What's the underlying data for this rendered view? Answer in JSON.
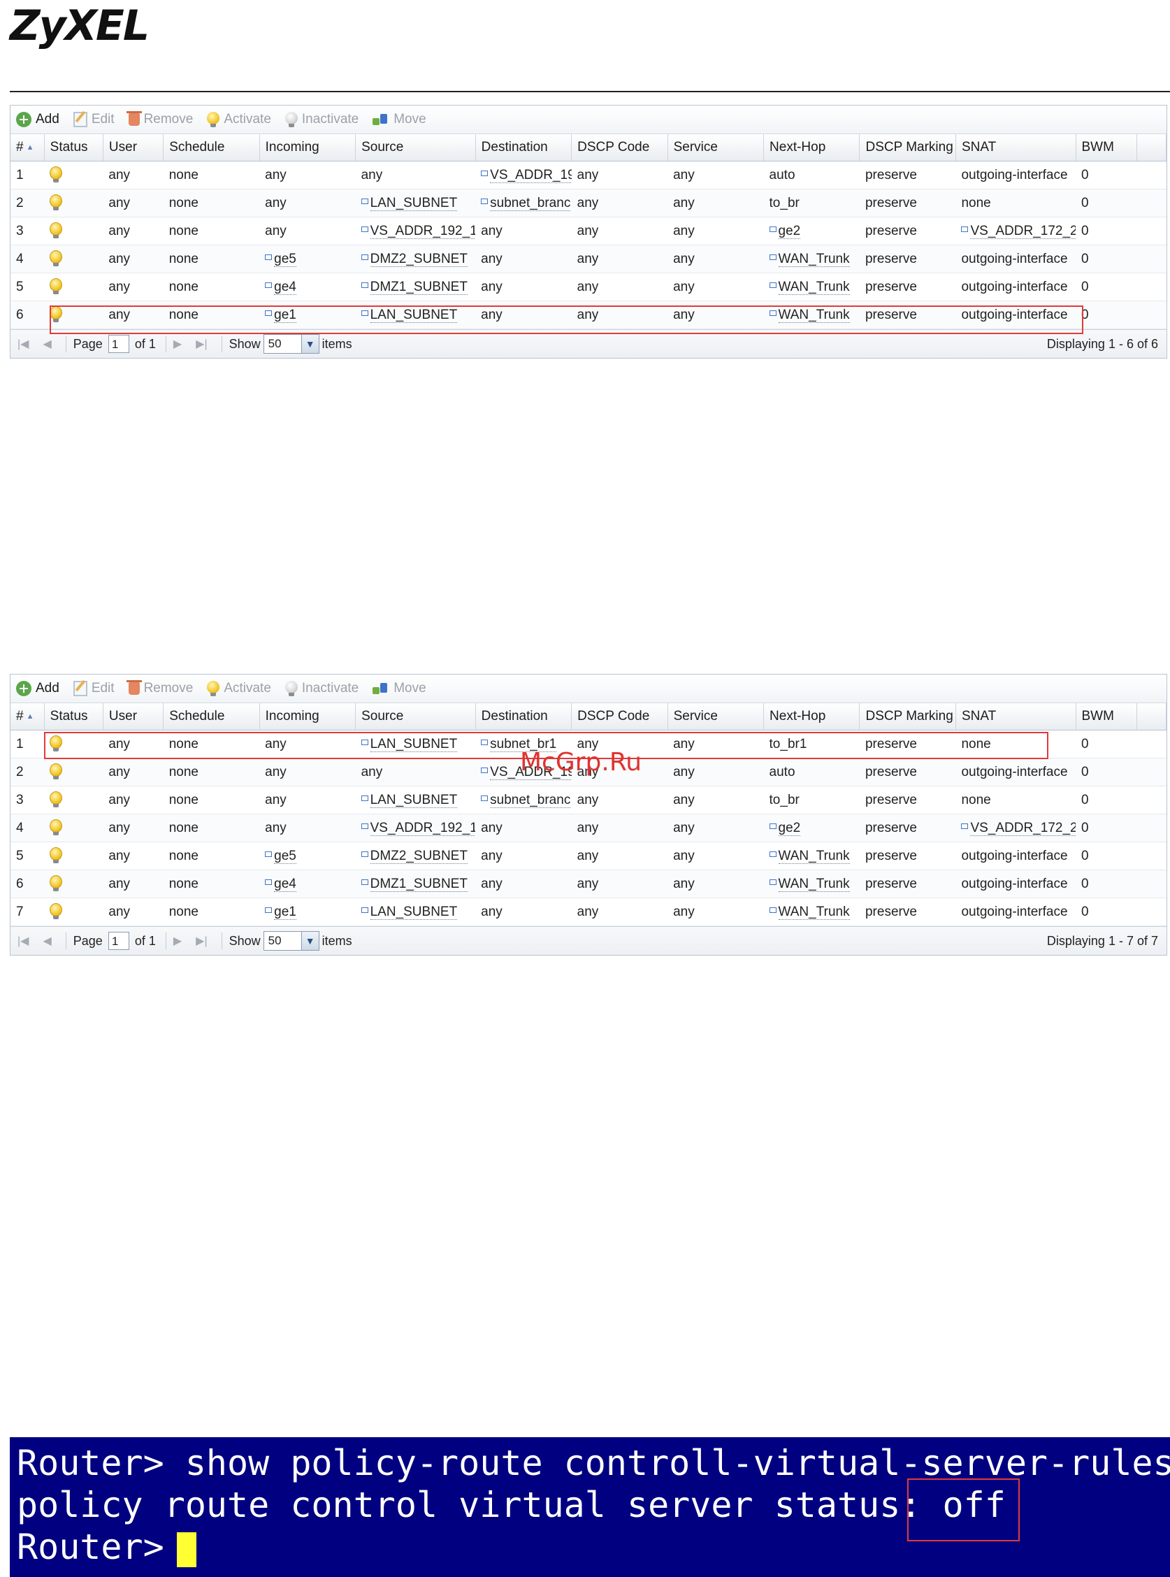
{
  "brand": {
    "logo_text": "ZyXEL"
  },
  "toolbar": {
    "add": "Add",
    "edit": "Edit",
    "remove": "Remove",
    "activate": "Activate",
    "inactivate": "Inactivate",
    "move": "Move"
  },
  "columns": [
    "#",
    "Status",
    "User",
    "Schedule",
    "Incoming",
    "Source",
    "Destination",
    "DSCP Code",
    "Service",
    "Next-Hop",
    "DSCP Marking",
    "SNAT",
    "BWM"
  ],
  "table1": {
    "rows": [
      {
        "num": "1",
        "user": "any",
        "schedule": "none",
        "incoming": "any",
        "source": "any",
        "destination": "VS_ADDR_19",
        "dscp_code": "any",
        "service": "any",
        "next_hop": "auto",
        "dscp_marking": "preserve",
        "snat": "outgoing-interface",
        "bwm": "0"
      },
      {
        "num": "2",
        "user": "any",
        "schedule": "none",
        "incoming": "any",
        "source": "LAN_SUBNET",
        "destination": "subnet_branc",
        "dscp_code": "any",
        "service": "any",
        "next_hop": "to_br",
        "dscp_marking": "preserve",
        "snat": "none",
        "bwm": "0"
      },
      {
        "num": "3",
        "user": "any",
        "schedule": "none",
        "incoming": "any",
        "source": "VS_ADDR_192_1(",
        "destination": "any",
        "dscp_code": "any",
        "service": "any",
        "next_hop": "ge2",
        "dscp_marking": "preserve",
        "snat": "VS_ADDR_172_2!",
        "bwm": "0"
      },
      {
        "num": "4",
        "user": "any",
        "schedule": "none",
        "incoming": "ge5",
        "source": "DMZ2_SUBNET",
        "destination": "any",
        "dscp_code": "any",
        "service": "any",
        "next_hop": "WAN_Trunk",
        "dscp_marking": "preserve",
        "snat": "outgoing-interface",
        "bwm": "0"
      },
      {
        "num": "5",
        "user": "any",
        "schedule": "none",
        "incoming": "ge4",
        "source": "DMZ1_SUBNET",
        "destination": "any",
        "dscp_code": "any",
        "service": "any",
        "next_hop": "WAN_Trunk",
        "dscp_marking": "preserve",
        "snat": "outgoing-interface",
        "bwm": "0"
      },
      {
        "num": "6",
        "user": "any",
        "schedule": "none",
        "incoming": "ge1",
        "source": "LAN_SUBNET",
        "destination": "any",
        "dscp_code": "any",
        "service": "any",
        "next_hop": "WAN_Trunk",
        "dscp_marking": "preserve",
        "snat": "outgoing-interface",
        "bwm": "0"
      }
    ],
    "pager": {
      "page_label": "Page",
      "page_value": "1",
      "of_label": "of 1",
      "show_label": "Show",
      "show_value": "50",
      "items_label": "items",
      "status": "Displaying 1 - 6 of 6"
    }
  },
  "table2": {
    "rows": [
      {
        "num": "1",
        "user": "any",
        "schedule": "none",
        "incoming": "any",
        "source": "LAN_SUBNET",
        "destination": "subnet_br1",
        "dscp_code": "any",
        "service": "any",
        "next_hop": "to_br1",
        "dscp_marking": "preserve",
        "snat": "none",
        "bwm": "0"
      },
      {
        "num": "2",
        "user": "any",
        "schedule": "none",
        "incoming": "any",
        "source": "any",
        "destination": "VS_ADDR_19",
        "dscp_code": "any",
        "service": "any",
        "next_hop": "auto",
        "dscp_marking": "preserve",
        "snat": "outgoing-interface",
        "bwm": "0"
      },
      {
        "num": "3",
        "user": "any",
        "schedule": "none",
        "incoming": "any",
        "source": "LAN_SUBNET",
        "destination": "subnet_branc",
        "dscp_code": "any",
        "service": "any",
        "next_hop": "to_br",
        "dscp_marking": "preserve",
        "snat": "none",
        "bwm": "0"
      },
      {
        "num": "4",
        "user": "any",
        "schedule": "none",
        "incoming": "any",
        "source": "VS_ADDR_192_1(",
        "destination": "any",
        "dscp_code": "any",
        "service": "any",
        "next_hop": "ge2",
        "dscp_marking": "preserve",
        "snat": "VS_ADDR_172_2!",
        "bwm": "0"
      },
      {
        "num": "5",
        "user": "any",
        "schedule": "none",
        "incoming": "ge5",
        "source": "DMZ2_SUBNET",
        "destination": "any",
        "dscp_code": "any",
        "service": "any",
        "next_hop": "WAN_Trunk",
        "dscp_marking": "preserve",
        "snat": "outgoing-interface",
        "bwm": "0"
      },
      {
        "num": "6",
        "user": "any",
        "schedule": "none",
        "incoming": "ge4",
        "source": "DMZ1_SUBNET",
        "destination": "any",
        "dscp_code": "any",
        "service": "any",
        "next_hop": "WAN_Trunk",
        "dscp_marking": "preserve",
        "snat": "outgoing-interface",
        "bwm": "0"
      },
      {
        "num": "7",
        "user": "any",
        "schedule": "none",
        "incoming": "ge1",
        "source": "LAN_SUBNET",
        "destination": "any",
        "dscp_code": "any",
        "service": "any",
        "next_hop": "WAN_Trunk",
        "dscp_marking": "preserve",
        "snat": "outgoing-interface",
        "bwm": "0"
      }
    ],
    "pager": {
      "page_label": "Page",
      "page_value": "1",
      "of_label": "of 1",
      "show_label": "Show",
      "show_value": "50",
      "items_label": "items",
      "status": "Displaying 1 - 7 of 7"
    }
  },
  "watermark": "McGrp.Ru",
  "terminal": {
    "line1": "Router> show policy-route controll-virtual-server-rules",
    "line2_prefix": "policy route control virtual server status: ",
    "line2_status": "off",
    "line3": "Router>"
  },
  "colors": {
    "highlight": "#e03b3b",
    "terminal_bg": "#000080",
    "cursor": "#ffff33"
  }
}
